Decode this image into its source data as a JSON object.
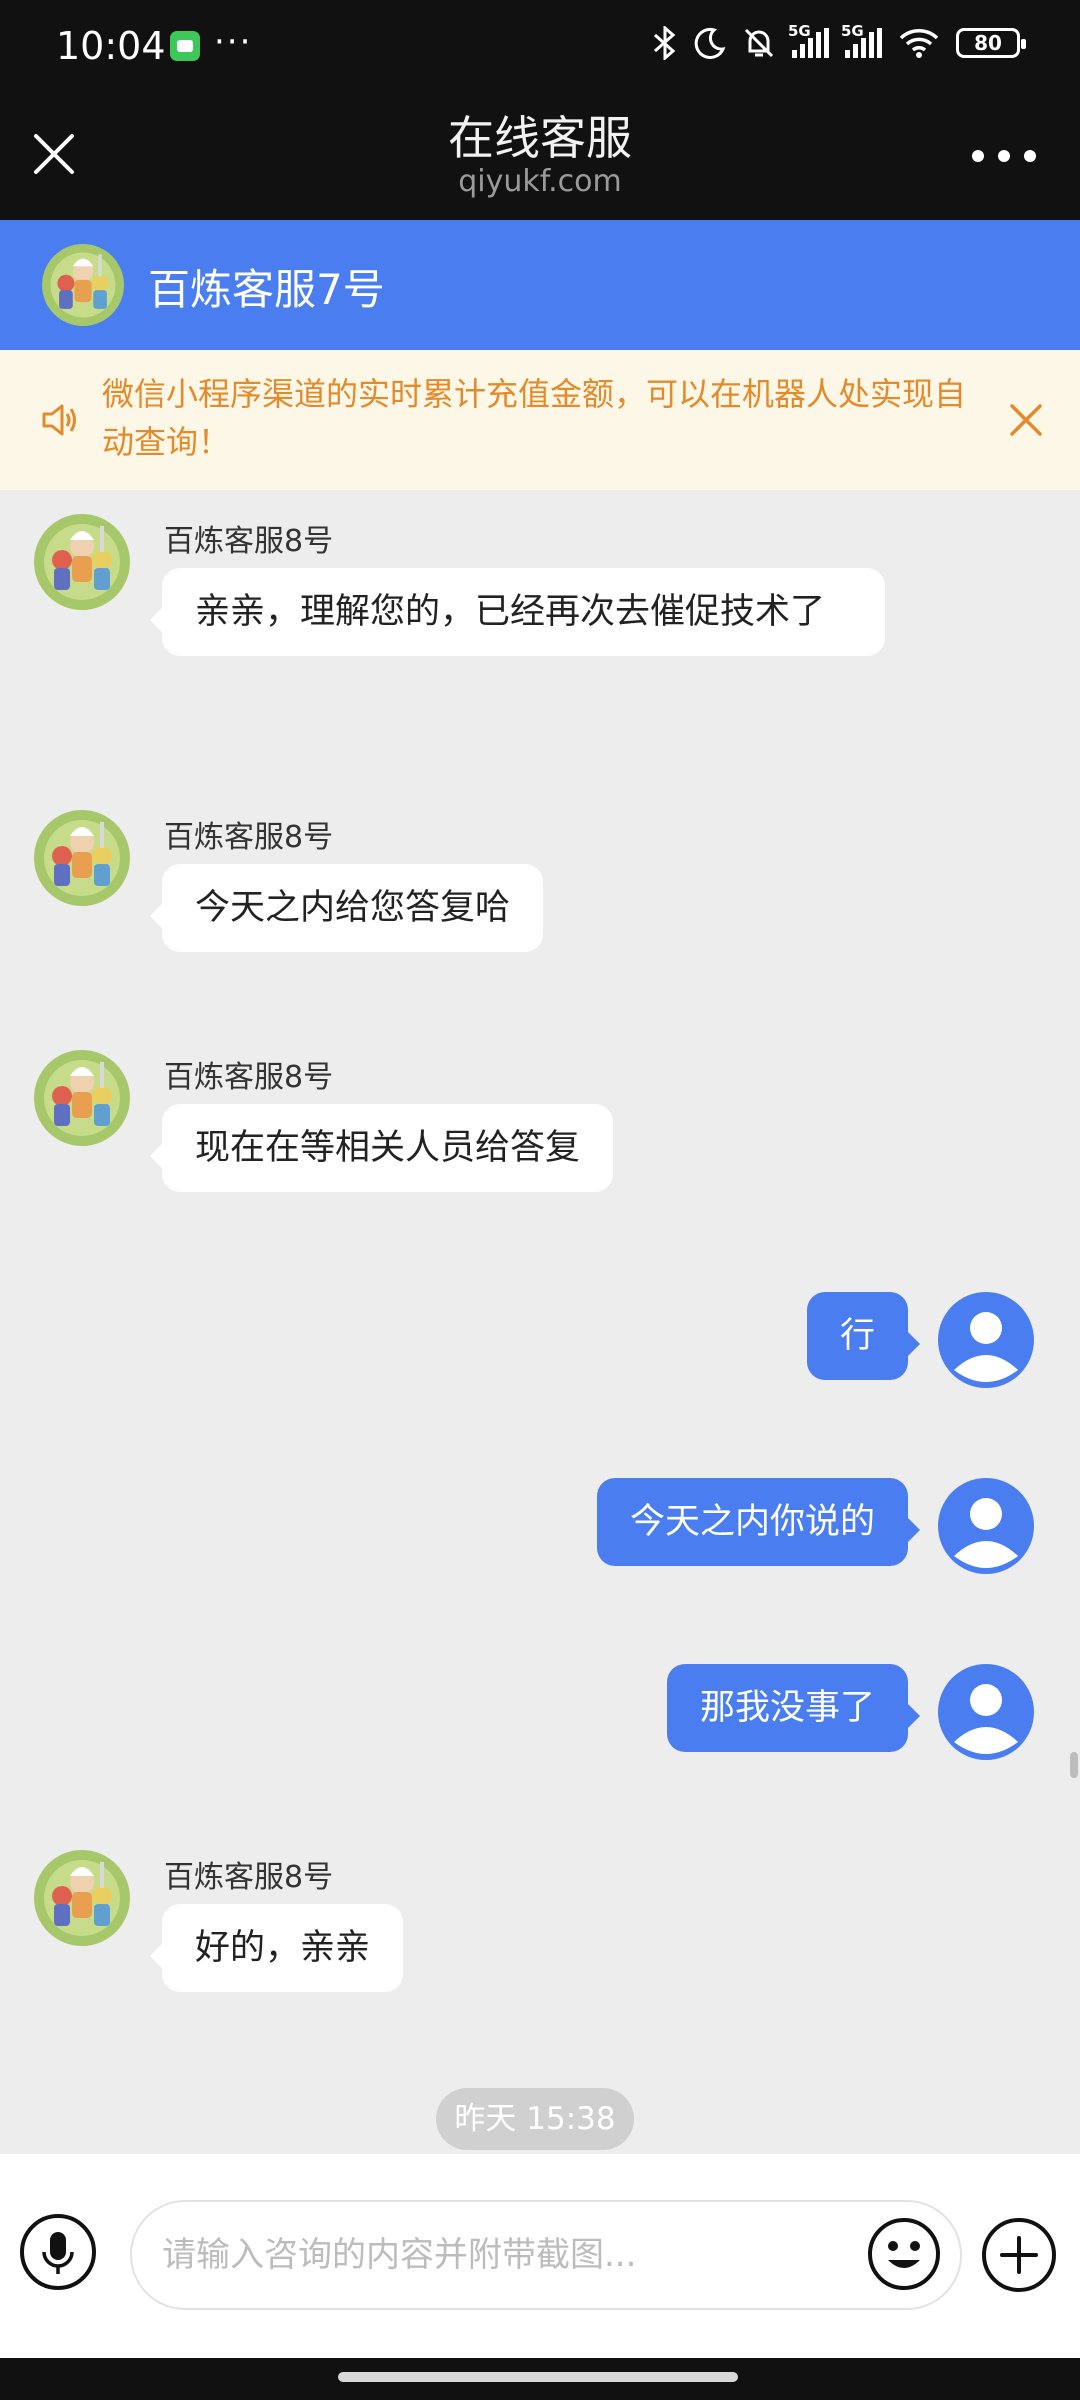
{
  "status_bar": {
    "time": "10:04",
    "more": "···",
    "network_1": "5G",
    "network_2": "5G",
    "battery": "80"
  },
  "title_bar": {
    "title": "在线客服",
    "subtitle": "qiyukf.com"
  },
  "agent_header": {
    "name": "百炼客服7号"
  },
  "notice": {
    "text": "微信小程序渠道的实时累计充值金额，可以在机器人处实现自动查询！"
  },
  "messages": [
    {
      "sender": "百炼客服8号",
      "text": "亲亲，理解您的，已经再次去催促技术了",
      "direction": "in"
    },
    {
      "sender": "百炼客服8号",
      "text": "今天之内给您答复哈",
      "direction": "in"
    },
    {
      "sender": "百炼客服8号",
      "text": "现在在等相关人员给答复",
      "direction": "in"
    },
    {
      "text": "行",
      "direction": "out"
    },
    {
      "text": "今天之内你说的",
      "direction": "out"
    },
    {
      "text": "那我没事了",
      "direction": "out"
    },
    {
      "sender": "百炼客服8号",
      "text": "好的，亲亲",
      "direction": "in"
    }
  ],
  "timestamp": "昨天 15:38",
  "input": {
    "placeholder": "请输入咨询的内容并附带截图..."
  },
  "colors": {
    "accent": "#4a7ef0",
    "notice_text": "#e38a2a",
    "notice_bg": "#fdf7e8",
    "chat_bg": "#ededed",
    "bar_bg": "#111111"
  }
}
